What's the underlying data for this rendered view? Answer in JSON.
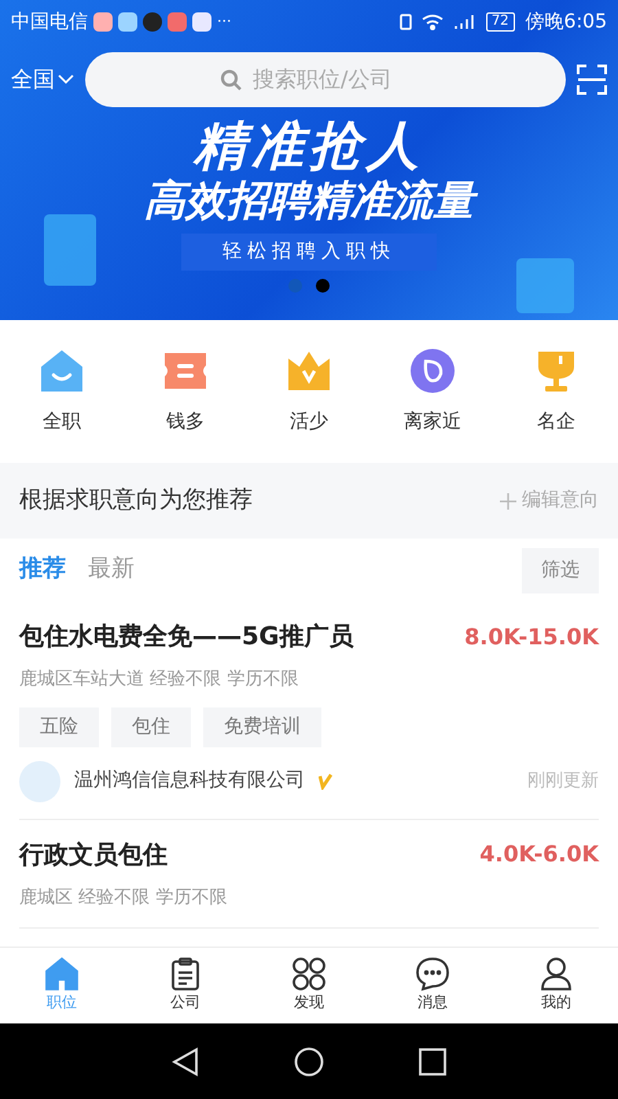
{
  "status_bar": {
    "carrier": "中国电信",
    "more": "···",
    "battery": "72",
    "time": "傍晚6:05"
  },
  "header": {
    "location": "全国",
    "search": {
      "placeholder": "搜索职位/公司"
    }
  },
  "banner": {
    "headline": "精准抢人",
    "subhead": "高效招聘精准流量",
    "tagline": "轻松招聘入职快",
    "dots": [
      {
        "selected": false
      },
      {
        "selected": true
      }
    ]
  },
  "categories": [
    {
      "kind": "house",
      "label": "全职"
    },
    {
      "kind": "ticket",
      "label": "钱多"
    },
    {
      "kind": "crown",
      "label": "活少"
    },
    {
      "kind": "pin",
      "label": "离家近"
    },
    {
      "kind": "trophy",
      "label": "名企"
    }
  ],
  "recommend_bar": {
    "title": "根据求职意向为您推荐",
    "action": "编辑意向"
  },
  "list_tabs": [
    {
      "label": "推荐",
      "selected": true
    },
    {
      "label": "最新",
      "selected": false
    }
  ],
  "filter_button": "筛选",
  "jobs": [
    {
      "title": "包住水电费全免——5G推广员",
      "salary": "8.0K-15.0K",
      "meta": "鹿城区车站大道 经验不限 学历不限",
      "tags": [
        "五险",
        "包住",
        "免费培训"
      ],
      "company": "温州鸿信信息科技有限公司",
      "verified": true,
      "updated": "刚刚更新"
    },
    {
      "title": "行政文员包住",
      "salary": "4.0K-6.0K",
      "meta": "鹿城区 经验不限 学历不限"
    }
  ],
  "bottom_nav": [
    {
      "kind": "home",
      "label": "职位",
      "selected": true
    },
    {
      "kind": "clipboard",
      "label": "公司",
      "selected": false
    },
    {
      "kind": "grid",
      "label": "发现",
      "selected": false
    },
    {
      "kind": "chat",
      "label": "消息",
      "selected": false
    },
    {
      "kind": "user",
      "label": "我的",
      "selected": false
    }
  ]
}
